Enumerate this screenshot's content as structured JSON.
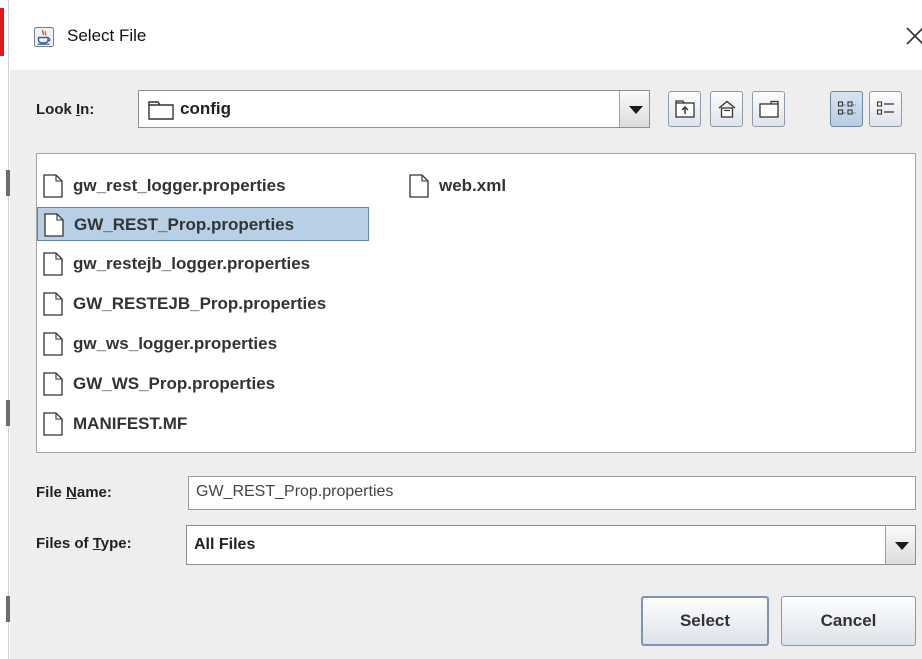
{
  "dialog": {
    "title": "Select File",
    "close_glyph": "×",
    "icon": "java-cup-icon"
  },
  "look_in": {
    "label_prefix": "Look ",
    "label_mnemonic": "I",
    "label_suffix": "n:",
    "value": "config",
    "value_icon": "folder-icon"
  },
  "toolbar": {
    "buttons": [
      {
        "name": "up-one-level",
        "icon": "up-folder-icon"
      },
      {
        "name": "home",
        "icon": "home-icon"
      },
      {
        "name": "new-folder",
        "icon": "new-folder-icon"
      },
      {
        "name": "list-view",
        "icon": "list-view-icon",
        "active": true
      },
      {
        "name": "details-view",
        "icon": "details-view-icon",
        "active": false
      }
    ]
  },
  "files": [
    "gw_rest_logger.properties",
    "GW_REST_Prop.properties",
    "gw_restejb_logger.properties",
    "GW_RESTEJB_Prop.properties",
    "gw_ws_logger.properties",
    "GW_WS_Prop.properties",
    "MANIFEST.MF",
    "web.xml"
  ],
  "selected_file": "GW_REST_Prop.properties",
  "file_name": {
    "label_prefix": "File ",
    "label_mnemonic": "N",
    "label_suffix": "ame:",
    "value": "GW_REST_Prop.properties"
  },
  "files_of_type": {
    "label_prefix": "Files of ",
    "label_mnemonic": "T",
    "label_suffix": "ype:",
    "value": "All Files"
  },
  "buttons": {
    "select": "Select",
    "cancel": "Cancel"
  },
  "colors": {
    "selection_bg": "#b8cfe5",
    "selection_border": "#5f85b0",
    "panel_bg": "#eeeeee"
  }
}
